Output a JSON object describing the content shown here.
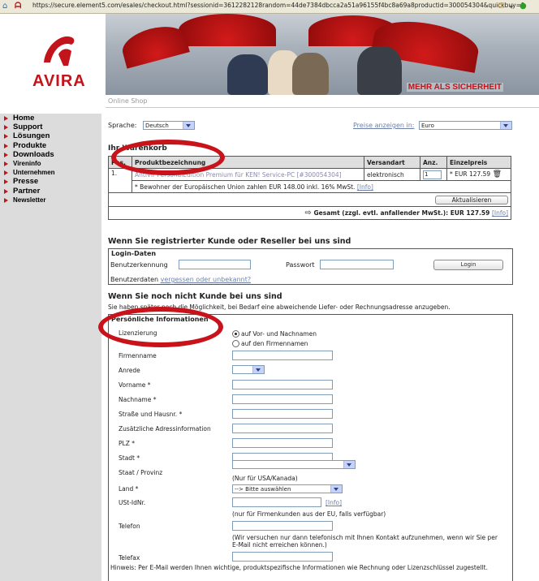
{
  "browser": {
    "url": "https://secure.element5.com/esales/checkout.html?sessionid=3612282128random=44de7384dbcca2a51a96155f4bc8a69a8productid=300054304&quickbuy=1"
  },
  "brand": {
    "logo_text": "AVIRA",
    "tagline": "MEHR ALS SICHERHEIT",
    "shop_label": "Online Shop",
    "accent": "#c4141b"
  },
  "nav": {
    "items": [
      {
        "label": "Home"
      },
      {
        "label": "Support"
      },
      {
        "label": "Lösungen"
      },
      {
        "label": "Produkte"
      },
      {
        "label": "Downloads"
      },
      {
        "label": "Vireninfo"
      },
      {
        "label": "Unternehmen"
      },
      {
        "label": "Presse"
      },
      {
        "label": "Partner"
      },
      {
        "label": "Newsletter"
      }
    ]
  },
  "toolbar": {
    "language_label": "Sprache:",
    "language_value": "Deutsch",
    "price_label": "Preise anzeigen in:",
    "currency_value": "Euro"
  },
  "cart": {
    "title": "Ihr Warenkorb",
    "headers": [
      "Pos.",
      "Produktbezeichnung",
      "Versandart",
      "Anz.",
      "Einzelpreis"
    ],
    "row": {
      "pos": "1.",
      "product": "AntiVir PersonalEdition Premium für KEN! Service-PC [#300054304]",
      "shipping": "elektronisch",
      "qty": "1",
      "price": "* EUR 127.59"
    },
    "note": "* Bewohner der Europäischen Union zahlen EUR 148.00 inkl. 16% MwSt.",
    "info": "[Info]",
    "update_label": "Aktualisieren",
    "total": "Gesamt (zzgl. evtl. anfallender MwSt.): EUR 127.59"
  },
  "login": {
    "heading": "Wenn Sie registrierter Kunde oder Reseller bei uns sind",
    "section": "Login-Daten",
    "user_label": "Benutzerkennung",
    "pass_label": "Passwort",
    "button": "Login",
    "forgot_prefix": "Benutzerdaten",
    "forgot_link": "vergessen oder unbekannt?"
  },
  "newcust": {
    "heading": "Wenn Sie noch nicht Kunde bei uns sind",
    "sub": "Sie haben später noch die Möglichkeit, bei Bedarf eine abweichende Liefer- oder Rechnungsadresse anzugeben.",
    "section": "Persönliche Informationen",
    "lic_label": "Lizenzierung",
    "lic_opt1": "auf Vor- und Nachnamen",
    "lic_opt2": "auf den Firmennamen",
    "fields": {
      "firma": "Firmenname",
      "anrede": "Anrede",
      "vorname": "Vorname *",
      "nachname": "Nachname *",
      "strasse": "Straße und Hausnr. *",
      "zusatz": "Zusätzliche Adressinformation",
      "plz": "PLZ *",
      "stadt": "Stadt *",
      "staat": "Staat / Provinz",
      "land": "Land *",
      "ust": "USt-IdNr.",
      "telefon": "Telefon",
      "telefax": "Telefax"
    },
    "staat_note": "(Nur für USA/Kanada)",
    "land_value": "--> Bitte auswählen",
    "ust_note": "(nur für Firmenkunden aus der EU, falls verfügbar)",
    "info": "[Info]",
    "tel_note": "(Wir versuchen nur dann telefonisch mit Ihnen Kontakt aufzunehmen, wenn wir Sie per E-Mail nicht erreichen können.)",
    "hint": "Hinweis: Per E-Mail werden Ihnen wichtige, produktspezifische Informationen wie Rechnung oder Lizenzschlüssel zugestellt."
  },
  "annotation_color": "#c8131b"
}
